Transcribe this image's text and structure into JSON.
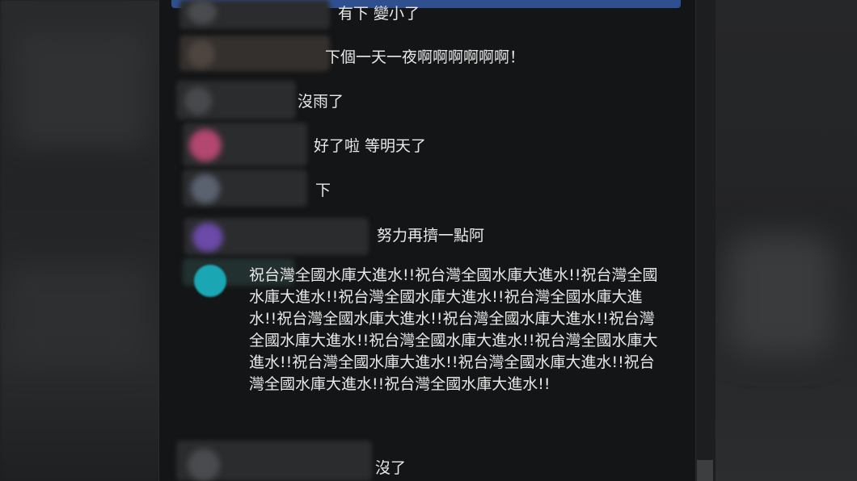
{
  "chat": {
    "messages": [
      {
        "text": "有下 變小了"
      },
      {
        "text": "下個一天一夜啊啊啊啊啊啊！"
      },
      {
        "text": "沒雨了"
      },
      {
        "text": "好了啦 等明天了"
      },
      {
        "text": "下"
      },
      {
        "text": "努力再擠一點阿"
      },
      {
        "text": "祝台灣全國水庫大進水!!祝台灣全國水庫大進水!!祝台灣全國水庫大進水!!祝台灣全國水庫大進水!!祝台灣全國水庫大進水!!祝台灣全國水庫大進水!!祝台灣全國水庫大進水!!祝台灣全國水庫大進水!!祝台灣全國水庫大進水!!祝台灣全國水庫大進水!!祝台灣全國水庫大進水!!祝台灣全國水庫大進水!!祝台灣全國水庫大進水!!祝台灣全國水庫大進水!!"
      },
      {
        "text": "沒了"
      }
    ]
  },
  "colors": {
    "panel_bg": "#141516",
    "text": "#e9e9e9",
    "banner": "#2f4f8f",
    "avatar_pink": "#b2476f",
    "avatar_purple": "#6b4aa8",
    "avatar_teal": "#1aa6b2"
  }
}
